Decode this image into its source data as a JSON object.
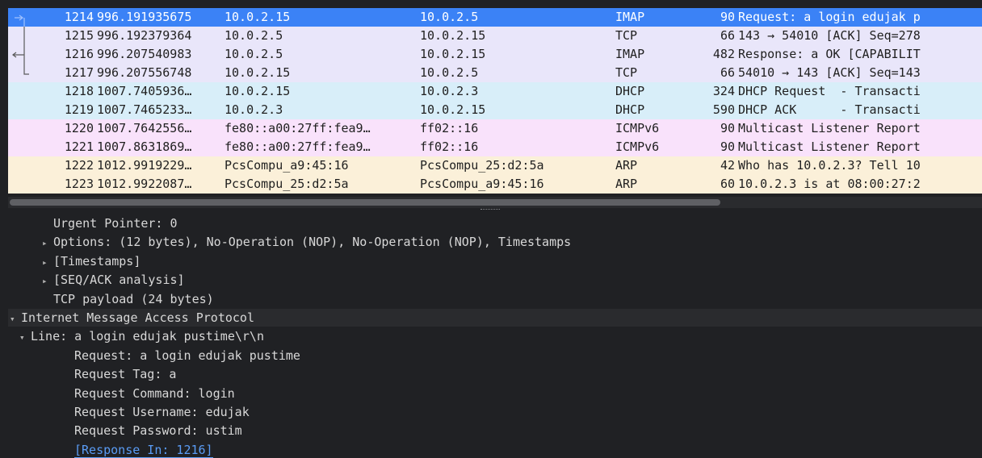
{
  "packet_list": {
    "colors": {
      "selected": "#3b82f6",
      "tcp_imap": "#e9e6fa",
      "dhcp": "#d8eef9",
      "icmpv6": "#f9e2fb",
      "arp": "#fbf0d9",
      "relation_line": "#5a5a5a"
    },
    "rows": [
      {
        "no": "1214",
        "time": "996.191935675",
        "src": "10.0.2.15",
        "dst": "10.0.2.5",
        "proto": "IMAP",
        "len": "90",
        "info": "Request: a login edujak p",
        "style": "selected",
        "rel": "request"
      },
      {
        "no": "1215",
        "time": "996.192379364",
        "src": "10.0.2.5",
        "dst": "10.0.2.15",
        "proto": "TCP",
        "len": "66",
        "info": "143 → 54010 [ACK] Seq=278",
        "style": "tcp_imap",
        "rel": "mid"
      },
      {
        "no": "1216",
        "time": "996.207540983",
        "src": "10.0.2.5",
        "dst": "10.0.2.15",
        "proto": "IMAP",
        "len": "482",
        "info": "Response: a OK [CAPABILIT",
        "style": "tcp_imap",
        "rel": "response"
      },
      {
        "no": "1217",
        "time": "996.207556748",
        "src": "10.0.2.15",
        "dst": "10.0.2.5",
        "proto": "TCP",
        "len": "66",
        "info": "54010 → 143 [ACK] Seq=143",
        "style": "tcp_imap",
        "rel": "end"
      },
      {
        "no": "1218",
        "time": "1007.7405936…",
        "src": "10.0.2.15",
        "dst": "10.0.2.3",
        "proto": "DHCP",
        "len": "324",
        "info": "DHCP Request  - Transacti",
        "style": "dhcp",
        "rel": ""
      },
      {
        "no": "1219",
        "time": "1007.7465233…",
        "src": "10.0.2.3",
        "dst": "10.0.2.15",
        "proto": "DHCP",
        "len": "590",
        "info": "DHCP ACK      - Transacti",
        "style": "dhcp",
        "rel": ""
      },
      {
        "no": "1220",
        "time": "1007.7642556…",
        "src": "fe80::a00:27ff:fea9…",
        "dst": "ff02::16",
        "proto": "ICMPv6",
        "len": "90",
        "info": "Multicast Listener Report",
        "style": "icmpv6",
        "rel": ""
      },
      {
        "no": "1221",
        "time": "1007.8631869…",
        "src": "fe80::a00:27ff:fea9…",
        "dst": "ff02::16",
        "proto": "ICMPv6",
        "len": "90",
        "info": "Multicast Listener Report",
        "style": "icmpv6",
        "rel": ""
      },
      {
        "no": "1222",
        "time": "1012.9919229…",
        "src": "PcsCompu_a9:45:16",
        "dst": "PcsCompu_25:d2:5a",
        "proto": "ARP",
        "len": "42",
        "info": "Who has 10.0.2.3? Tell 10",
        "style": "arp",
        "rel": ""
      },
      {
        "no": "1223",
        "time": "1012.9922087…",
        "src": "PcsCompu_25:d2:5a",
        "dst": "PcsCompu_a9:45:16",
        "proto": "ARP",
        "len": "60",
        "info": "10.0.2.3 is at 08:00:27:2",
        "style": "arp",
        "rel": ""
      }
    ]
  },
  "details": {
    "rows": [
      {
        "indent": 2,
        "expander": "",
        "text": "Urgent Pointer: 0",
        "name": "urgent-pointer-field"
      },
      {
        "indent": 2,
        "expander": "collapsed",
        "text": "Options: (12 bytes), No-Operation (NOP), No-Operation (NOP), Timestamps",
        "name": "tcp-options-node"
      },
      {
        "indent": 2,
        "expander": "collapsed",
        "text": "[Timestamps]",
        "name": "timestamps-node"
      },
      {
        "indent": 2,
        "expander": "collapsed",
        "text": "[SEQ/ACK analysis]",
        "name": "seq-ack-analysis-node"
      },
      {
        "indent": 2,
        "expander": "",
        "text": "TCP payload (24 bytes)",
        "name": "tcp-payload-field"
      },
      {
        "indent": 0,
        "expander": "expanded",
        "text": "Internet Message Access Protocol",
        "name": "imap-protocol-node"
      },
      {
        "indent": 1,
        "expander": "expanded",
        "text": "Line: a login edujak pustime\\r\\n",
        "name": "imap-line-node"
      },
      {
        "indent": 3,
        "expander": "",
        "text": "Request: a login edujak pustime",
        "name": "imap-request-field"
      },
      {
        "indent": 3,
        "expander": "",
        "text": "Request Tag: a",
        "name": "imap-request-tag-field"
      },
      {
        "indent": 3,
        "expander": "",
        "text": "Request Command: login",
        "name": "imap-request-command-field"
      },
      {
        "indent": 3,
        "expander": "",
        "text": "Request Username: edujak",
        "name": "imap-request-username-field"
      },
      {
        "indent": 3,
        "expander": "",
        "text": "Request Password: ustim",
        "name": "imap-request-password-field"
      },
      {
        "indent": 3,
        "expander": "",
        "text": "[Response In: 1216]",
        "name": "response-in-link",
        "link": true
      }
    ]
  }
}
